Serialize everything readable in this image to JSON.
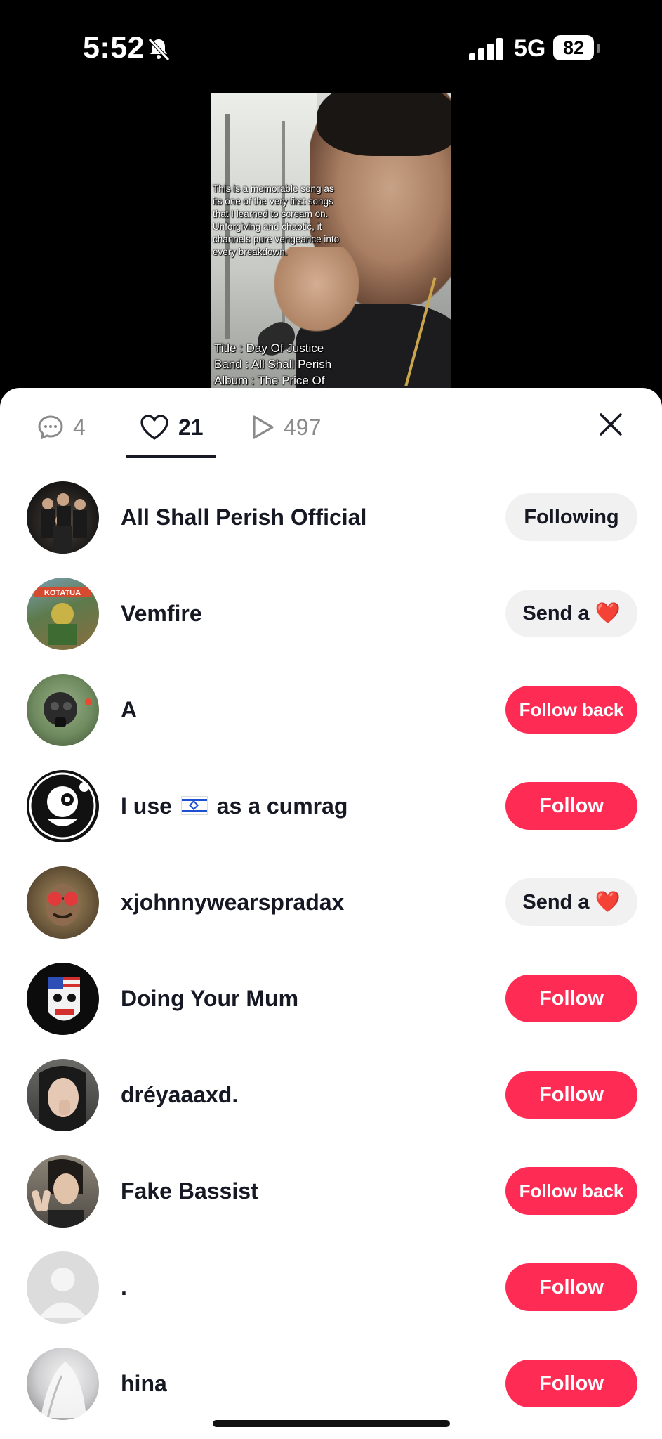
{
  "status_bar": {
    "time": "5:52",
    "network": "5G",
    "battery": "82"
  },
  "video": {
    "caption": [
      "This is a memorable song as",
      "its one of the very first songs",
      "that I learned to scream on.",
      "Unforgiving and chaotic, it",
      "channels pure vengeance into",
      "every breakdown."
    ],
    "title_line": "Title : Day Of Justice",
    "band_line": "Band : All Shall Perish",
    "album_line": "Album : The Price Of"
  },
  "tabs": {
    "comments_count": "4",
    "likes_count": "21",
    "views_count": "497"
  },
  "colors": {
    "accent": "#fe2c55",
    "text": "#161823",
    "muted": "#8a8a8a",
    "button_gray": "#f1f1f2"
  },
  "likers": [
    {
      "name": "All Shall Perish Official",
      "button": "Following",
      "style": "gray",
      "avatar": "band-photo"
    },
    {
      "name": "Vemfire",
      "button": "Send a",
      "button_icon": "❤️",
      "style": "gray",
      "avatar": "kotatua-art"
    },
    {
      "name": "A",
      "button": "Follow back",
      "style": "red",
      "avatar": "gas-mask"
    },
    {
      "name": "I use",
      "name_suffix": "as a cumrag",
      "name_flag": "israel-flag",
      "button": "Follow",
      "style": "red",
      "avatar": "cartoon-skull"
    },
    {
      "name": "xjohnnywearspradax",
      "button": "Send a",
      "button_icon": "❤️",
      "style": "gray",
      "avatar": "red-glasses"
    },
    {
      "name": "Doing Your Mum",
      "button": "Follow",
      "style": "red",
      "avatar": "flag-mask"
    },
    {
      "name": "dréyaaaxd.",
      "button": "Follow",
      "style": "red",
      "avatar": "selfie"
    },
    {
      "name": "Fake Bassist",
      "button": "Follow back",
      "style": "red",
      "avatar": "peace-sign"
    },
    {
      "name": ".",
      "button": "Follow",
      "style": "red",
      "avatar": "default-placeholder"
    },
    {
      "name": "hina",
      "button": "Follow",
      "style": "red",
      "avatar": "white-hair"
    }
  ]
}
